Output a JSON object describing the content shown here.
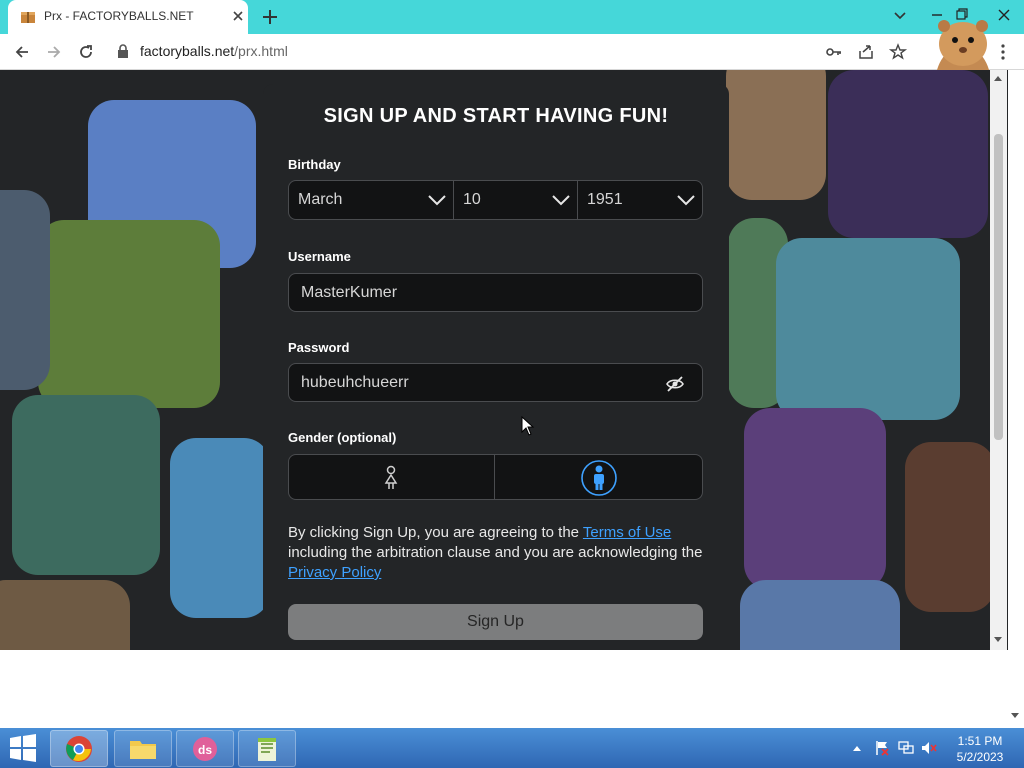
{
  "browser": {
    "tab_title": "Prx - FACTORYBALLS.NET",
    "url_host": "factoryballs.net",
    "url_path": "/prx.html"
  },
  "form": {
    "heading": "SIGN UP AND START HAVING FUN!",
    "birthday_label": "Birthday",
    "birth_month": "March",
    "birth_day": "10",
    "birth_year": "1951",
    "username_label": "Username",
    "username_value": "MasterKumer",
    "password_label": "Password",
    "password_value": "hubeuhchueerr",
    "gender_label": "Gender (optional)",
    "legal_prefix": "By clicking Sign Up, you are agreeing to the ",
    "terms_link": "Terms of Use",
    "legal_middle": " including the arbitration clause and you are acknowledging the ",
    "privacy_link": "Privacy Policy",
    "signup_label": "Sign Up"
  },
  "taskbar": {
    "time": "1:51 PM",
    "date": "5/2/2023"
  },
  "icons": {
    "tab_favicon": "box-icon",
    "close_tab": "close-icon",
    "new_tab": "plus-icon",
    "back": "arrow-left-icon",
    "forward": "arrow-right-icon",
    "reload": "reload-icon",
    "lock": "lock-icon",
    "key": "key-icon",
    "share": "share-icon",
    "bookmark": "star-icon",
    "menu": "kebab-menu-icon",
    "password_toggle": "eye-slash-icon",
    "gender_female": "female-icon",
    "gender_male": "male-icon"
  },
  "colors": {
    "chrome_tab_strip": "#45d7d9",
    "panel_bg": "#232527",
    "link": "#3ea1ff",
    "selected_gender": "#3ea1ff",
    "signup_button": "#7c7d7e"
  }
}
